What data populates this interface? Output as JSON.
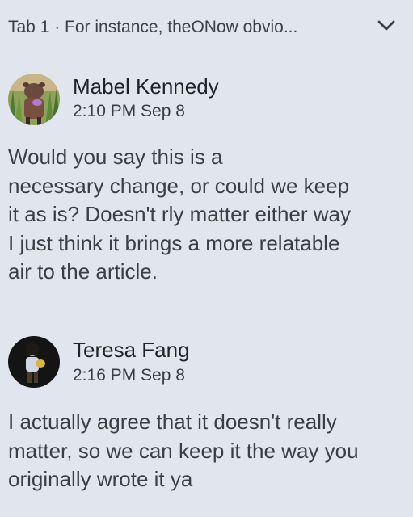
{
  "header": {
    "title": "Tab 1 · For instance, theONow obvio...",
    "chevron_icon": "chevron-down-icon"
  },
  "comments": [
    {
      "author": "Mabel Kennedy",
      "timestamp": "2:10 PM Sep 8",
      "body": "Would you say this is a\nnecessary change, or could we keep\nit as is? Doesn't rly matter either way\nI just think it brings a more relatable\nair to the article."
    },
    {
      "author": "Teresa Fang",
      "timestamp": "2:16 PM Sep 8",
      "body": "I actually agree that it doesn't really\nmatter, so we can keep it the way you\noriginally wrote it ya"
    }
  ],
  "colors": {
    "background": "#e1e6ee",
    "text": "#3b3f45",
    "author": "#1f2227"
  }
}
